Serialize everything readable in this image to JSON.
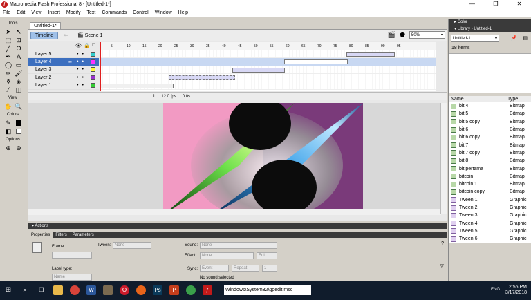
{
  "app": {
    "title": "Macromedia Flash Professional 8 - [Untitled-1*]",
    "icon": "flash-app-icon"
  },
  "window": {
    "minimize": "—",
    "maximize": "❐",
    "close": "✕"
  },
  "menu": [
    "File",
    "Edit",
    "View",
    "Insert",
    "Modify",
    "Text",
    "Commands",
    "Control",
    "Window",
    "Help"
  ],
  "tools": {
    "title": "Tools",
    "view": "View",
    "colors": "Colors",
    "options": "Options"
  },
  "document": {
    "tab": "Untitled-1*",
    "timeline_btn": "Timeline",
    "scene": "Scene 1",
    "zoom": "50%"
  },
  "layers": [
    {
      "name": "Layer 5",
      "color": "#33cccc"
    },
    {
      "name": "Layer 4",
      "color": "#ff33ff",
      "selected": true
    },
    {
      "name": "Layer 3",
      "color": "#ffff33"
    },
    {
      "name": "Layer 2",
      "color": "#9933cc"
    },
    {
      "name": "Layer 1",
      "color": "#33cc33"
    }
  ],
  "ruler": [
    "5",
    "10",
    "15",
    "20",
    "25",
    "30",
    "35",
    "40",
    "45",
    "50",
    "55",
    "60",
    "65",
    "70",
    "75",
    "80",
    "85",
    "90",
    "95"
  ],
  "tlstatus": {
    "frame": "1",
    "fps": "12.0 fps",
    "time": "0.0s"
  },
  "panels": {
    "actions": "Actions",
    "tabs": [
      "Properties",
      "Filters",
      "Parameters"
    ],
    "frame_label": "Frame",
    "tween_label": "Tween:",
    "tween_value": "None",
    "sound_label": "Sound:",
    "sound_value": "None",
    "effect_label": "Effect:",
    "effect_value": "None",
    "edit_btn": "Edit...",
    "sync_label": "Sync:",
    "sync_value": "Event",
    "repeat_value": "Repeat",
    "repeat_count": "1",
    "no_sound": "No sound selected",
    "label_type": "Label type:",
    "label_type_value": "Name"
  },
  "right": {
    "color_panel": "Color",
    "library_panel": "Library - Untitled-1",
    "library_select": "Untitled-1",
    "count": "18 items",
    "col_name": "Name",
    "col_type": "Type",
    "items": [
      {
        "name": "bit 4",
        "type": "Bitmap"
      },
      {
        "name": "bit 5",
        "type": "Bitmap"
      },
      {
        "name": "bit 5 copy",
        "type": "Bitmap"
      },
      {
        "name": "bit 6",
        "type": "Bitmap"
      },
      {
        "name": "bit 6 copy",
        "type": "Bitmap"
      },
      {
        "name": "bit 7",
        "type": "Bitmap"
      },
      {
        "name": "bit 7 copy",
        "type": "Bitmap"
      },
      {
        "name": "bit 8",
        "type": "Bitmap"
      },
      {
        "name": "bit pertama",
        "type": "Bitmap"
      },
      {
        "name": "bitcoin",
        "type": "Bitmap"
      },
      {
        "name": "bitcoin 1",
        "type": "Bitmap"
      },
      {
        "name": "bitcoin copy",
        "type": "Bitmap"
      },
      {
        "name": "Tween 1",
        "type": "Graphic"
      },
      {
        "name": "Tween 2",
        "type": "Graphic"
      },
      {
        "name": "Tween 3",
        "type": "Graphic"
      },
      {
        "name": "Tween 4",
        "type": "Graphic"
      },
      {
        "name": "Tween 5",
        "type": "Graphic"
      },
      {
        "name": "Tween 6",
        "type": "Graphic"
      }
    ]
  },
  "taskbar": {
    "address": "Windows\\System32\\gpedit.msc",
    "lang": "ENG",
    "time": "2:56 PM",
    "date": "3/17/2018"
  }
}
